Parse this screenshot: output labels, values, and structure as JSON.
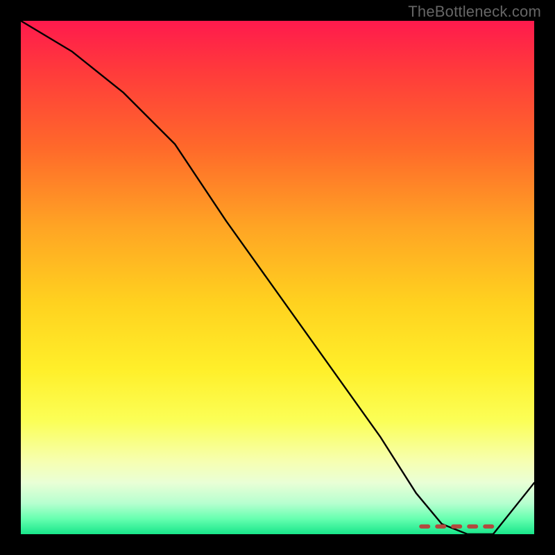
{
  "watermark": "TheBottleneck.com",
  "colors": {
    "background": "#000000",
    "curve": "#000000",
    "valley_marker": "#b24a3e",
    "gradient_top": "#ff1a4d",
    "gradient_bottom": "#18e68a"
  },
  "chart_data": {
    "type": "line",
    "title": "",
    "xlabel": "",
    "ylabel": "",
    "xlim": [
      0,
      100
    ],
    "ylim": [
      0,
      100
    ],
    "background_gradient": {
      "direction": "vertical",
      "stops": [
        {
          "pos": 0,
          "color": "#ff1a4d"
        },
        {
          "pos": 25,
          "color": "#ff6a2a"
        },
        {
          "pos": 55,
          "color": "#ffd21f"
        },
        {
          "pos": 86,
          "color": "#f6ffb3"
        },
        {
          "pos": 100,
          "color": "#18e68a"
        }
      ]
    },
    "series": [
      {
        "name": "bottleneck-curve",
        "x": [
          0,
          10,
          20,
          30,
          40,
          50,
          60,
          70,
          77,
          82,
          87,
          92,
          100
        ],
        "y": [
          100,
          94,
          86,
          76,
          61,
          47,
          33,
          19,
          8,
          2,
          0,
          0,
          10
        ]
      }
    ],
    "annotations": [
      {
        "name": "optimal-range",
        "type": "segment",
        "x_start": 78,
        "x_end": 92,
        "y": 1.5,
        "style": "dashed",
        "color": "#b24a3e"
      }
    ]
  }
}
